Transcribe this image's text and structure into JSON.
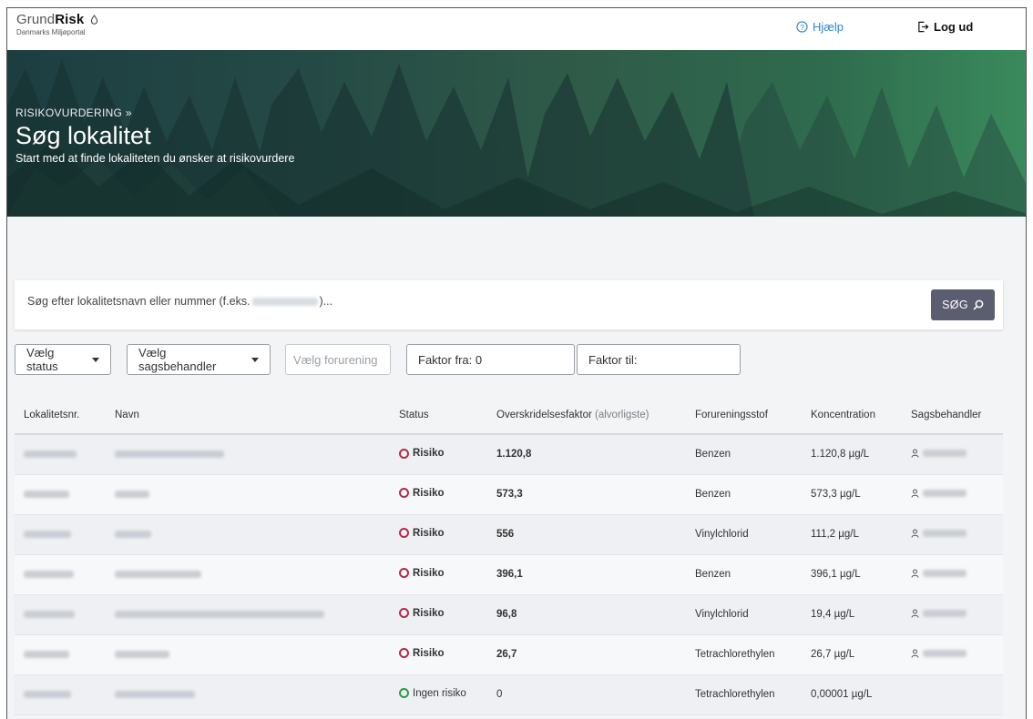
{
  "header": {
    "logo_light": "Grund",
    "logo_bold": "Risk",
    "logo_sub": "Danmarks Miljøportal",
    "help_label": "Hjælp",
    "logout_label": "Log ud"
  },
  "hero": {
    "breadcrumb": "RISIKOVURDERING »",
    "title": "Søg lokalitet",
    "subtitle": "Start med at finde lokaliteten du ønsker at risikovurdere"
  },
  "search": {
    "placeholder_start": "Søg efter lokalitetsnavn eller nummer (f.eks.",
    "placeholder_end": ")...",
    "button_label": "SØG"
  },
  "filters": {
    "status": "Vælg status",
    "caseworker": "Vælg sagsbehandler",
    "pollutant": "Vælg forurening",
    "factor_from": "Faktor fra: 0",
    "factor_to": "Faktor til:"
  },
  "table": {
    "headers": {
      "id": "Lokalitetsnr.",
      "name": "Navn",
      "status": "Status",
      "factor": "Overskridelsesfaktor",
      "factor_sub": "(alvorligste)",
      "pollutant": "Forureningsstof",
      "concentration": "Koncentration",
      "caseworker": "Sagsbehandler"
    },
    "rows": [
      {
        "status": "Risiko",
        "factor": "1.120,8",
        "pollutant": "Benzen",
        "concentration": "1.120,8 µg/L"
      },
      {
        "status": "Risiko",
        "factor": "573,3",
        "pollutant": "Benzen",
        "concentration": "573,3 µg/L"
      },
      {
        "status": "Risiko",
        "factor": "556",
        "pollutant": "Vinylchlorid",
        "concentration": "111,2 µg/L"
      },
      {
        "status": "Risiko",
        "factor": "396,1",
        "pollutant": "Benzen",
        "concentration": "396,1 µg/L"
      },
      {
        "status": "Risiko",
        "factor": "96,8",
        "pollutant": "Vinylchlorid",
        "concentration": "19,4 µg/L"
      },
      {
        "status": "Risiko",
        "factor": "26,7",
        "pollutant": "Tetrachlorethylen",
        "concentration": "26,7 µg/L"
      },
      {
        "status": "Ingen risiko",
        "factor": "0",
        "pollutant": "Tetrachlorethylen",
        "concentration": "0,00001 µg/L"
      }
    ]
  },
  "colors": {
    "risk": "#b42b4b",
    "no_risk": "#2e9b45",
    "accent": "#2f86c9",
    "button": "#5b5d70"
  }
}
